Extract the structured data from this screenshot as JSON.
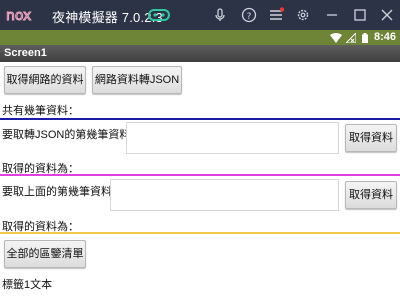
{
  "emulator": {
    "logo_text": "nox",
    "title": "夜神模擬器 7.0.2.3",
    "icons": [
      "gamepad-icon",
      "mute-icon",
      "help-icon",
      "menu-icon",
      "settings-icon",
      "minimize-icon",
      "maximize-icon",
      "close-icon"
    ],
    "notification_dot_color": "#e53935"
  },
  "status_bar": {
    "time": "8:46",
    "icons": [
      "wifi-icon",
      "no-signal-icon",
      "battery-icon"
    ],
    "background_color": "#6e8537"
  },
  "app": {
    "screen_title": "Screen1",
    "buttons": {
      "fetch_web": "取得網路的資料",
      "web_to_json": "網路資料轉JSON",
      "get_data_1": "取得資料",
      "get_data_2": "取得資料",
      "all_regions": "全部的區鑒清單"
    },
    "labels": {
      "total_records": "共有幾筆資料：",
      "json_nth_record": "要取轉JSON的第幾筆資料",
      "result_1": "取得的資料為：",
      "above_nth_record": "要取上面的第幾筆資料",
      "result_2": "取得的資料為：",
      "label1": "標籤1文本"
    },
    "divider_colors": {
      "first": "#1a1aa8",
      "second": "#e040e0",
      "third": "#f2c94c"
    }
  }
}
